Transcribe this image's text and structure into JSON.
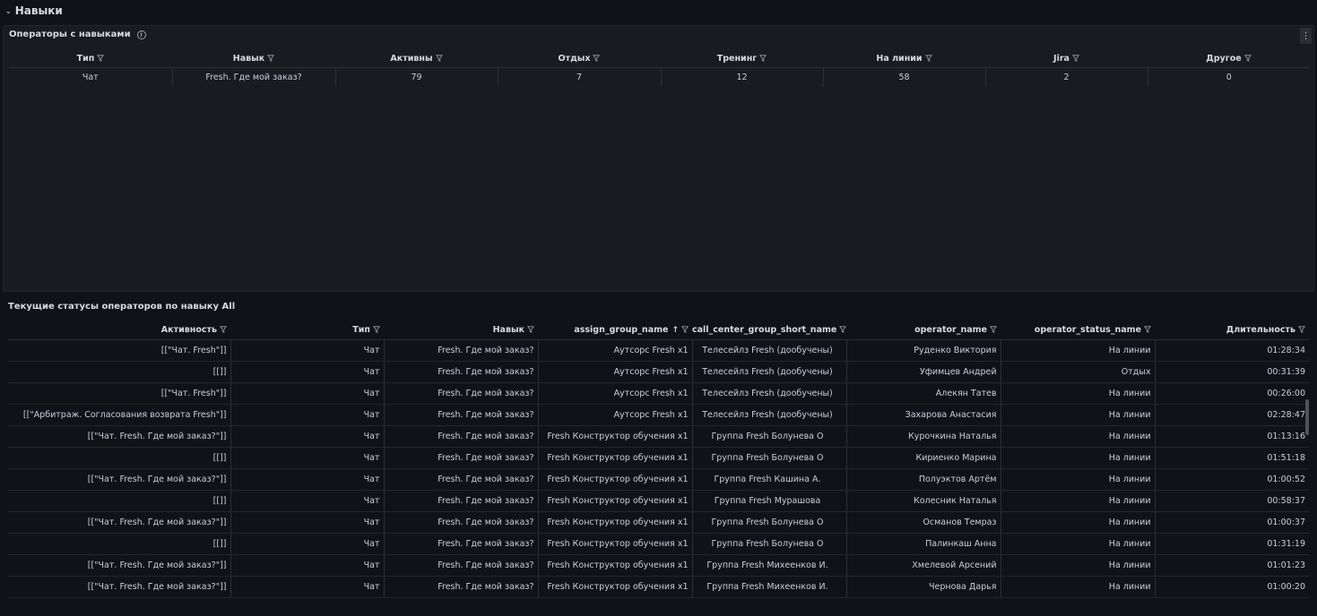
{
  "section": {
    "title": "Навыки"
  },
  "panel1": {
    "title": "Операторы с навыками",
    "columns": [
      "Тип",
      "Навык",
      "Активны",
      "Отдых",
      "Тренинг",
      "На линии",
      "Jira",
      "Другое"
    ],
    "rows": [
      [
        "Чат",
        "Fresh. Где мой заказ?",
        "79",
        "7",
        "12",
        "58",
        "2",
        "0"
      ]
    ]
  },
  "panel2": {
    "title": "Текущие статусы операторов по навыку All",
    "columns": [
      "Активность",
      "Тип",
      "Навык",
      "assign_group_name",
      "call_center_group_short_name",
      "operator_name",
      "operator_status_name",
      "Длительность"
    ],
    "rows": [
      [
        "[[\"Чат. Fresh\"]]",
        "Чат",
        "Fresh. Где мой заказ?",
        "Аутсорс Fresh x1",
        "Телесейлз Fresh (дообучены)",
        "Руденко Виктория",
        "На линии",
        "01:28:34"
      ],
      [
        "[[]]",
        "Чат",
        "Fresh. Где мой заказ?",
        "Аутсорс Fresh x1",
        "Телесейлз Fresh (дообучены)",
        "Уфимцев Андрей",
        "Отдых",
        "00:31:39"
      ],
      [
        "[[\"Чат. Fresh\"]]",
        "Чат",
        "Fresh. Где мой заказ?",
        "Аутсорс Fresh x1",
        "Телесейлз Fresh (дообучены)",
        "Алекян Татев",
        "На линии",
        "00:26:00"
      ],
      [
        "[[\"Арбитраж. Согласования возврата Fresh\"]]",
        "Чат",
        "Fresh. Где мой заказ?",
        "Аутсорс Fresh x1",
        "Телесейлз Fresh (дообучены)",
        "Захарова Анастасия",
        "На линии",
        "02:28:47"
      ],
      [
        "[[\"Чат. Fresh. Где мой заказ?\"]]",
        "Чат",
        "Fresh. Где мой заказ?",
        "Fresh Конструктор обучения x1",
        "Группа Fresh Болунева О",
        "Курочкина Наталья",
        "На линии",
        "01:13:16"
      ],
      [
        "[[]]",
        "Чат",
        "Fresh. Где мой заказ?",
        "Fresh Конструктор обучения x1",
        "Группа Fresh Болунева О",
        "Кириенко Марина",
        "На линии",
        "01:51:18"
      ],
      [
        "[[\"Чат. Fresh. Где мой заказ?\"]]",
        "Чат",
        "Fresh. Где мой заказ?",
        "Fresh Конструктор обучения x1",
        "Группа Fresh Кашина А.",
        "Полуэктов Артём",
        "На линии",
        "01:00:52"
      ],
      [
        "[[]]",
        "Чат",
        "Fresh. Где мой заказ?",
        "Fresh Конструктор обучения x1",
        "Группа Fresh Мурашова",
        "Колесник Наталья",
        "На линии",
        "00:58:37"
      ],
      [
        "[[\"Чат. Fresh. Где мой заказ?\"]]",
        "Чат",
        "Fresh. Где мой заказ?",
        "Fresh Конструктор обучения x1",
        "Группа Fresh Болунева О",
        "Османов Темраз",
        "На линии",
        "01:00:37"
      ],
      [
        "[[]]",
        "Чат",
        "Fresh. Где мой заказ?",
        "Fresh Конструктор обучения x1",
        "Группа Fresh Болунева О",
        "Палинкаш Анна",
        "На линии",
        "01:31:19"
      ],
      [
        "[[\"Чат. Fresh. Где мой заказ?\"]]",
        "Чат",
        "Fresh. Где мой заказ?",
        "Fresh Конструктор обучения x1",
        "Группа Fresh Михеенков И.",
        "Хмелевой Арсений",
        "На линии",
        "01:01:23"
      ],
      [
        "[[\"Чат. Fresh. Где мой заказ?\"]]",
        "Чат",
        "Fresh. Где мой заказ?",
        "Fresh Конструктор обучения x1",
        "Группа Fresh Михеенков И.",
        "Чернова Дарья",
        "На линии",
        "01:00:20"
      ]
    ]
  }
}
